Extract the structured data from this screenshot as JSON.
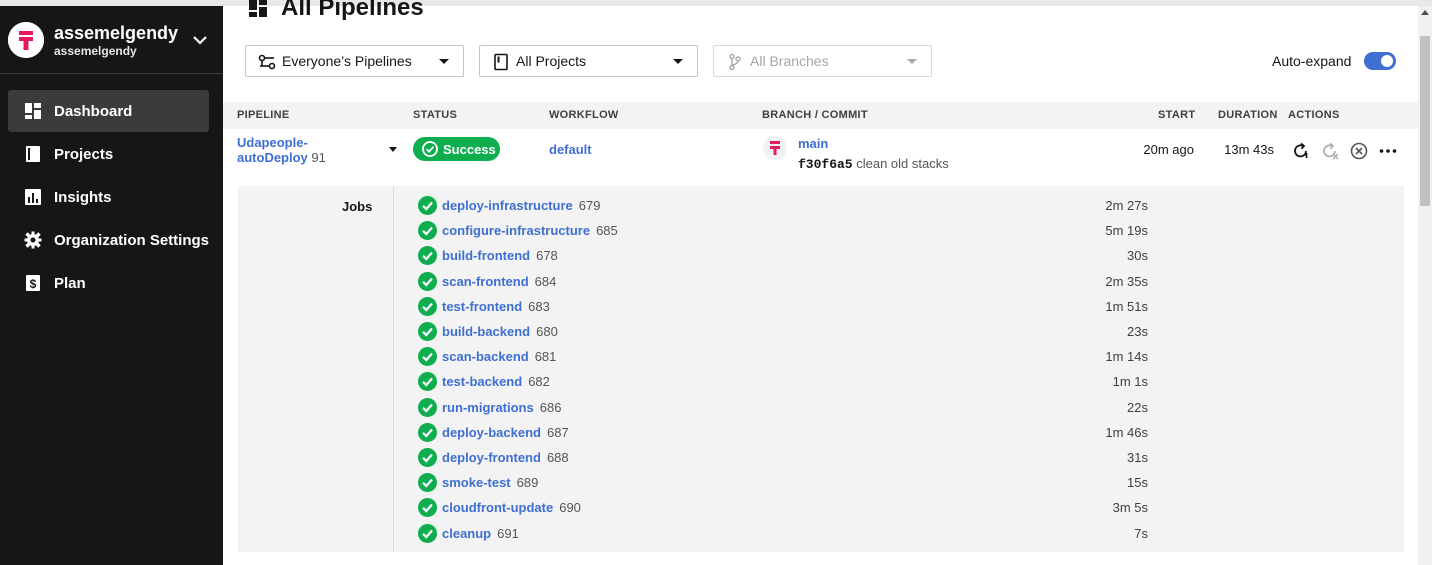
{
  "sidebar": {
    "org_name": "assemelgendy",
    "org_sub": "assemelgendy",
    "items": [
      {
        "label": "Dashboard",
        "icon": "dashboard-icon",
        "active": true
      },
      {
        "label": "Projects",
        "icon": "projects-icon"
      },
      {
        "label": "Insights",
        "icon": "insights-icon"
      },
      {
        "label": "Organization Settings",
        "icon": "gear-icon"
      },
      {
        "label": "Plan",
        "icon": "plan-icon"
      }
    ]
  },
  "header": {
    "title": "All Pipelines"
  },
  "filters": {
    "pipelines": "Everyone’s Pipelines",
    "projects": "All Projects",
    "branches": "All Branches"
  },
  "auto_expand": {
    "label": "Auto-expand",
    "enabled": true
  },
  "table": {
    "columns": [
      "PIPELINE",
      "STATUS",
      "WORKFLOW",
      "BRANCH / COMMIT",
      "START",
      "DURATION",
      "ACTIONS"
    ],
    "row": {
      "pipeline_line1": "Udapeople-",
      "pipeline_line2": "autoDeploy",
      "pipeline_number": "91",
      "status": "Success",
      "workflow": "default",
      "branch": "main",
      "commit_hash": "f30f6a5",
      "commit_message": "clean old stacks",
      "start": "20m ago",
      "duration": "13m 43s"
    }
  },
  "jobs": {
    "label": "Jobs",
    "items": [
      {
        "name": "deploy-infrastructure",
        "number": "679",
        "duration": "2m 27s"
      },
      {
        "name": "configure-infrastructure",
        "number": "685",
        "duration": "5m 19s"
      },
      {
        "name": "build-frontend",
        "number": "678",
        "duration": "30s"
      },
      {
        "name": "scan-frontend",
        "number": "684",
        "duration": "2m 35s"
      },
      {
        "name": "test-frontend",
        "number": "683",
        "duration": "1m 51s"
      },
      {
        "name": "build-backend",
        "number": "680",
        "duration": "23s"
      },
      {
        "name": "scan-backend",
        "number": "681",
        "duration": "1m 14s"
      },
      {
        "name": "test-backend",
        "number": "682",
        "duration": "1m 1s"
      },
      {
        "name": "run-migrations",
        "number": "686",
        "duration": "22s"
      },
      {
        "name": "deploy-backend",
        "number": "687",
        "duration": "1m 46s"
      },
      {
        "name": "deploy-frontend",
        "number": "688",
        "duration": "31s"
      },
      {
        "name": "smoke-test",
        "number": "689",
        "duration": "15s"
      },
      {
        "name": "cloudfront-update",
        "number": "690",
        "duration": "3m 5s"
      },
      {
        "name": "cleanup",
        "number": "691",
        "duration": "7s"
      }
    ]
  },
  "colors": {
    "sidebar_bg": "#161616",
    "accent_link": "#3e6fd1",
    "success": "#0eae4f",
    "brand": "#e31b5a"
  }
}
